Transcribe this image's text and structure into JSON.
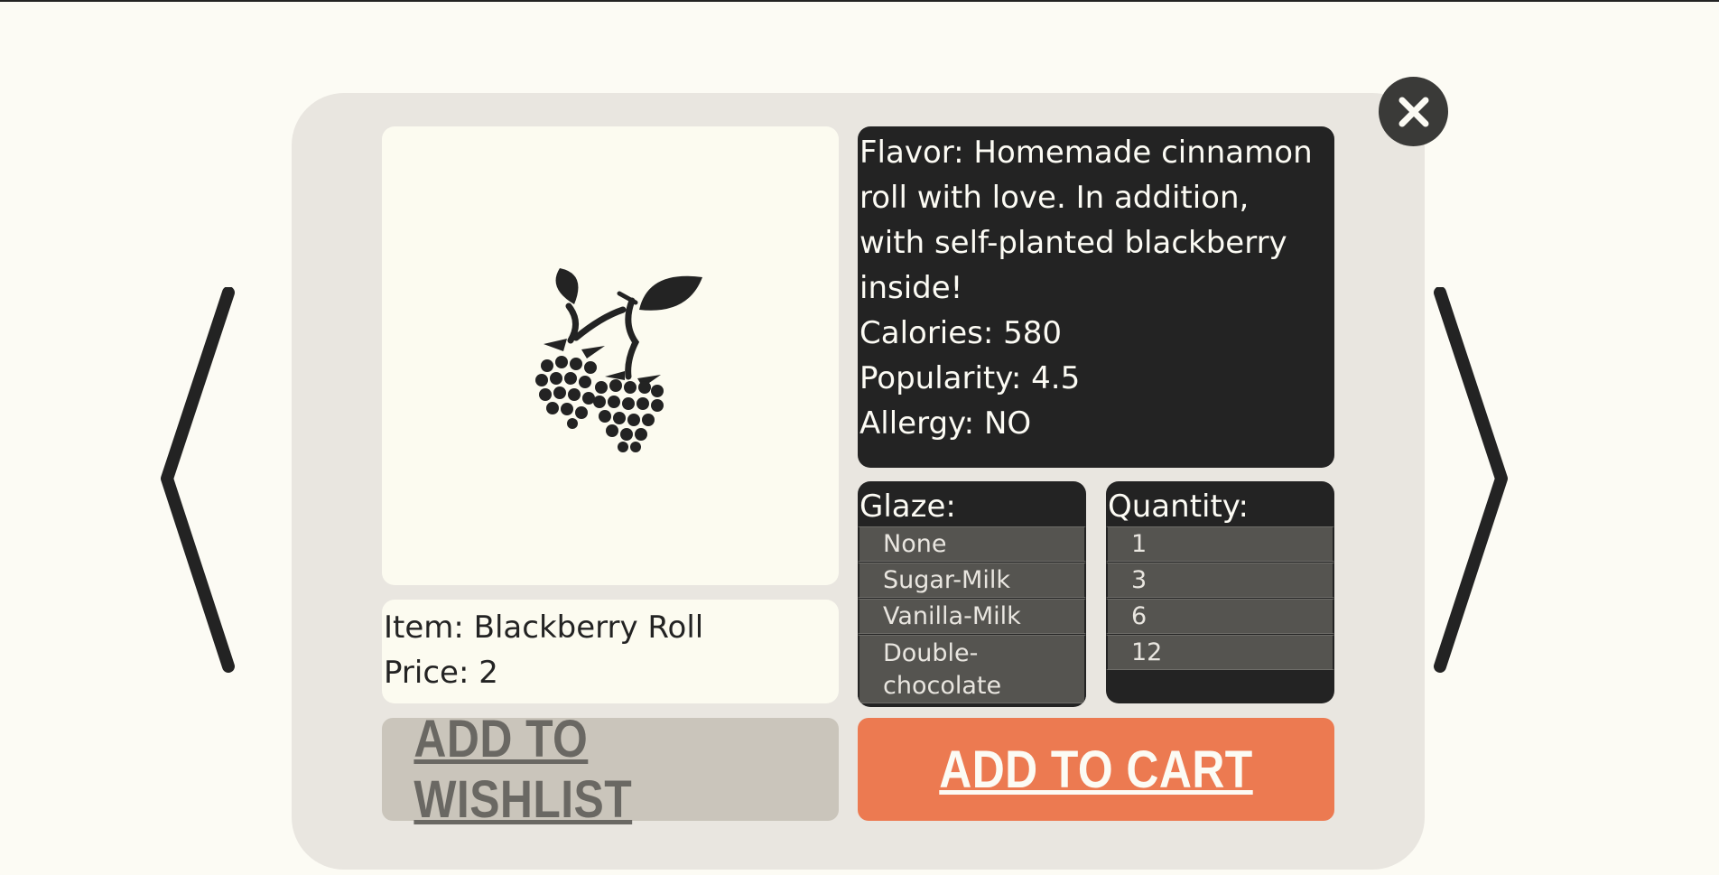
{
  "product": {
    "item_label": "Item: Blackberry Roll",
    "price_label": "Price: 2",
    "image_icon": "blackberry-icon"
  },
  "details": {
    "flavor": "Flavor: Homemade cinnamon roll with love. In addition, with self-planted blackberry inside!",
    "calories": "Calories: 580",
    "popularity": "Popularity: 4.5",
    "allergy": "Allergy: NO"
  },
  "glaze": {
    "label": "Glaze:",
    "options": [
      "None",
      "Sugar-Milk",
      "Vanilla-Milk",
      "Double-chocolate"
    ]
  },
  "quantity": {
    "label": "Quantity:",
    "options": [
      "1",
      "3",
      "6",
      "12"
    ]
  },
  "actions": {
    "wishlist_label": "ADD TO WISHLIST",
    "cart_label": "ADD TO CART"
  },
  "colors": {
    "background": "#fcfbf4",
    "modal": "#e9e6e0",
    "dark": "#232323",
    "accent": "#ec7a51",
    "wishlist": "#cac5bb"
  },
  "icons": {
    "close": "close-icon",
    "prev": "chevron-left-icon",
    "next": "chevron-right-icon"
  }
}
